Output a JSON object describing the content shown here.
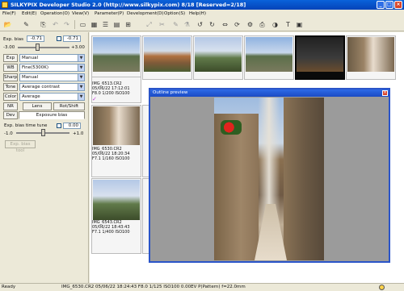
{
  "window": {
    "title": "SILKYPIX Developer Studio 2.0      (http://www.silkypix.com)  8/18 [Reserved=2/18]"
  },
  "menu": [
    "File(F)",
    "Edit(E)",
    "Operation(O)",
    "View(V)",
    "Parameter(P)",
    "Development(D)",
    "Option(S)",
    "Help(H)"
  ],
  "left_panel": {
    "exp_bias_label": "Exp. bias",
    "exp_bias_value": "-0.71",
    "exp_bias_value2": "-0.71",
    "exp_min": "-3.00",
    "exp_max": "+3.00",
    "exp_level": 0.38,
    "rows": [
      {
        "button": "Exp",
        "value": "Manual"
      },
      {
        "button": "WB",
        "value": "Fine(5300K)"
      },
      {
        "button": "Sharp",
        "value": "Manual"
      },
      {
        "button": "Tone",
        "value": "Average contrast"
      },
      {
        "button": "Color",
        "value": "Average"
      }
    ],
    "tabs": {
      "nr": "NR",
      "lens": "Lens",
      "rot": "Rot/Shift",
      "dev": "Dev",
      "expbias": "Exposure bias"
    },
    "exp_time_label": "Exp. bias time tune",
    "exp_time_value": "0.00",
    "exp_time_min": "-1.0",
    "exp_time_max": "+1.0",
    "exp_time_level": 0.5,
    "exp_bias_tool": "Exp. bias tool"
  },
  "thumbnails": [
    {
      "caption": "",
      "style": "sky",
      "selected": false
    },
    {
      "caption": "",
      "style": "town",
      "selected": false
    },
    {
      "caption": "",
      "style": "hill",
      "selected": false
    },
    {
      "caption": "",
      "style": "sky",
      "selected": false
    },
    {
      "caption": "",
      "style": "dark",
      "selected": true
    },
    {
      "caption": "",
      "style": "street",
      "selected": false
    }
  ],
  "grid_items": [
    {
      "line1": "IMG_6513.CR2",
      "line2": "05/06/22 17:12:01",
      "line3": "F8.0 1/200 ISO100",
      "style": "town"
    },
    {
      "line1": "IMG_6530.CR2",
      "line2": "05/06/22 18:20:34",
      "line3": "F7.1 1/160 ISO100",
      "style": "street"
    },
    {
      "line1": "IMG_6543.CR2",
      "line2": "05/06/22 18:43:43",
      "line3": "F7.1 1/400 ISO100",
      "style": "hill"
    }
  ],
  "preview": {
    "title": "Outline preview"
  },
  "status": {
    "ready": "Ready",
    "info": "IMG_6530.CR2 05/06/22 18:24:43 F8.0 1/125 ISO100  0.00EV P(Pattern) f=22.0mm"
  }
}
